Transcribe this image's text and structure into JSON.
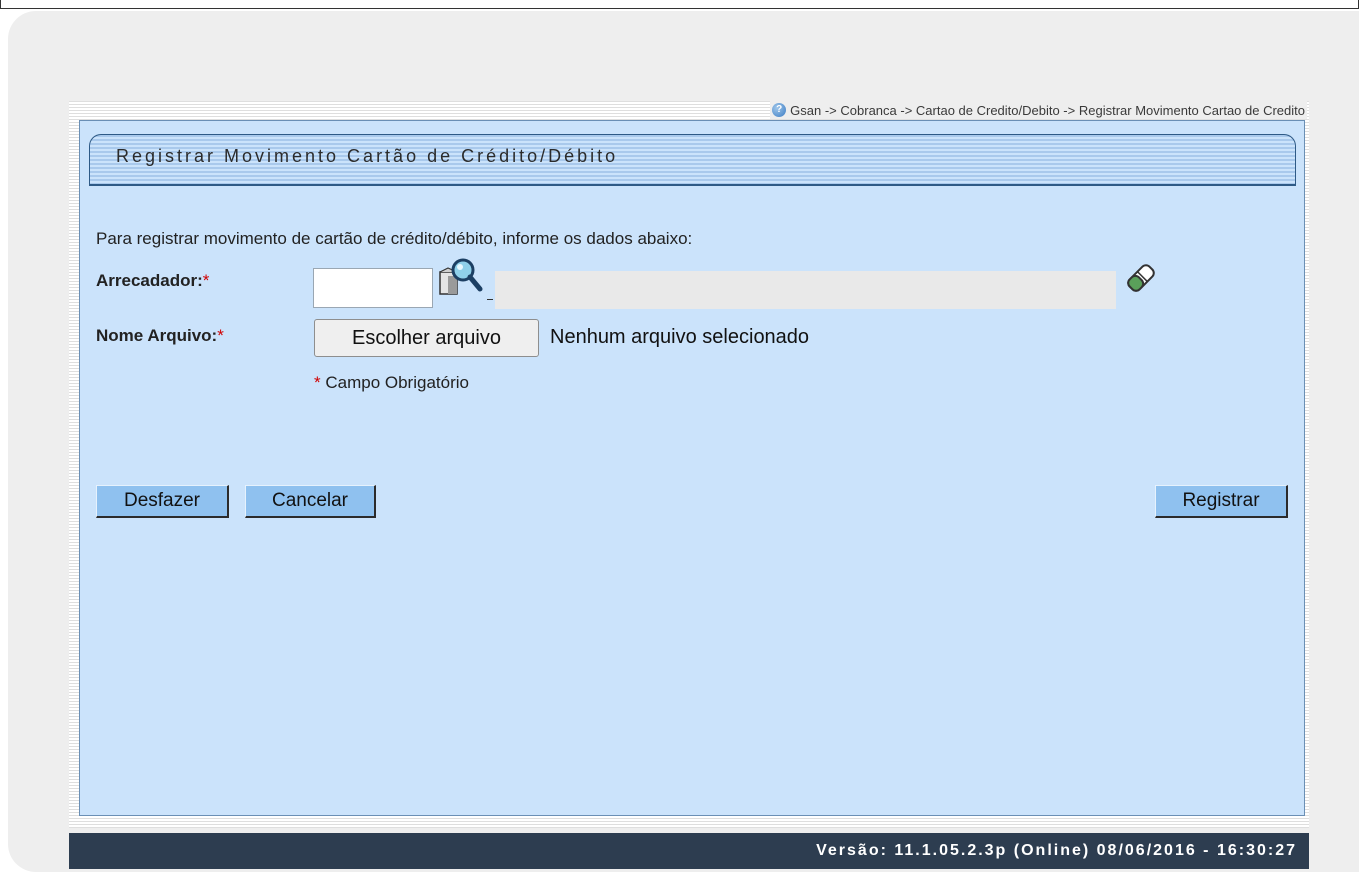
{
  "breadcrumb": "Gsan -> Cobranca -> Cartao de Credito/Debito -> Registrar Movimento Cartao de Credito",
  "page_title": "Registrar Movimento Cartão de Crédito/Débito",
  "intro_text": "Para registrar movimento de cartão de crédito/débito, informe os dados abaixo:",
  "form": {
    "arrecadador_label": "Arrecadador:",
    "arrecadador_value": "",
    "arrecadador_description": "",
    "nome_arquivo_label": "Nome Arquivo:",
    "file_button_label": "Escolher arquivo",
    "file_status": "Nenhum arquivo selecionado",
    "required_marker": "*",
    "required_note": "Campo Obrigatório"
  },
  "buttons": {
    "undo": "Desfazer",
    "cancel": "Cancelar",
    "submit": "Registrar"
  },
  "footer": "Versão: 11.1.05.2.3p (Online) 08/06/2016 - 16:30:27",
  "icons": {
    "help": "help-icon",
    "search": "magnifier-search-icon",
    "clear": "eraser-icon"
  },
  "colors": {
    "panel_background": "#cbe3fb",
    "button_background": "#8fc1ef",
    "footer_background": "#2d3d50",
    "required_marker": "#d00000"
  }
}
